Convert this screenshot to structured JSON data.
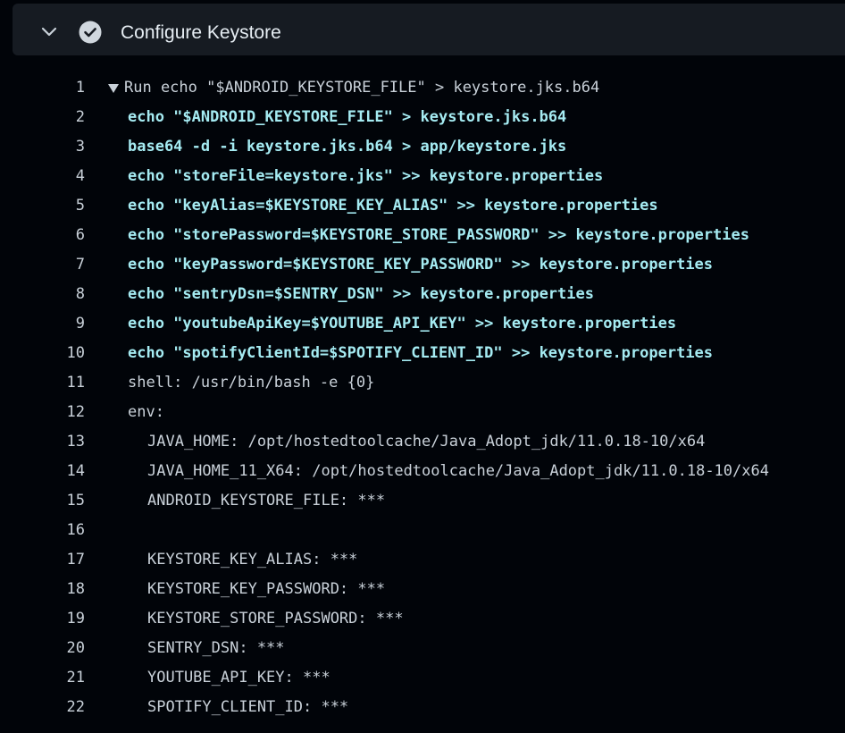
{
  "step": {
    "title": "Configure Keystore",
    "status": "success",
    "expanded": true,
    "chevron_icon": "chevron-down-icon",
    "status_icon": "check-circle-icon"
  },
  "colors": {
    "background": "#010409",
    "header_background": "#161b22",
    "text": "#c9d1d9",
    "command_text": "#a5ebf2",
    "check_circle": "#d0d7de"
  },
  "log": {
    "lines": [
      {
        "number": "1",
        "text": "Run echo \"$ANDROID_KEYSTORE_FILE\" > keystore.jks.b64",
        "kind": "run",
        "indent": 0
      },
      {
        "number": "2",
        "text": "echo \"$ANDROID_KEYSTORE_FILE\" > keystore.jks.b64",
        "kind": "cmd",
        "indent": 1
      },
      {
        "number": "3",
        "text": "base64 -d -i keystore.jks.b64 > app/keystore.jks",
        "kind": "cmd",
        "indent": 1
      },
      {
        "number": "4",
        "text": "echo \"storeFile=keystore.jks\" >> keystore.properties",
        "kind": "cmd",
        "indent": 1
      },
      {
        "number": "5",
        "text": "echo \"keyAlias=$KEYSTORE_KEY_ALIAS\" >> keystore.properties",
        "kind": "cmd",
        "indent": 1
      },
      {
        "number": "6",
        "text": "echo \"storePassword=$KEYSTORE_STORE_PASSWORD\" >> keystore.properties",
        "kind": "cmd",
        "indent": 1
      },
      {
        "number": "7",
        "text": "echo \"keyPassword=$KEYSTORE_KEY_PASSWORD\" >> keystore.properties",
        "kind": "cmd",
        "indent": 1
      },
      {
        "number": "8",
        "text": "echo \"sentryDsn=$SENTRY_DSN\" >> keystore.properties",
        "kind": "cmd",
        "indent": 1
      },
      {
        "number": "9",
        "text": "echo \"youtubeApiKey=$YOUTUBE_API_KEY\" >> keystore.properties",
        "kind": "cmd",
        "indent": 1
      },
      {
        "number": "10",
        "text": "echo \"spotifyClientId=$SPOTIFY_CLIENT_ID\" >> keystore.properties",
        "kind": "cmd",
        "indent": 1
      },
      {
        "number": "11",
        "text": "shell: /usr/bin/bash -e {0}",
        "kind": "plain",
        "indent": 1
      },
      {
        "number": "12",
        "text": "env:",
        "kind": "plain",
        "indent": 1
      },
      {
        "number": "13",
        "text": "JAVA_HOME: /opt/hostedtoolcache/Java_Adopt_jdk/11.0.18-10/x64",
        "kind": "plain",
        "indent": 2
      },
      {
        "number": "14",
        "text": "JAVA_HOME_11_X64: /opt/hostedtoolcache/Java_Adopt_jdk/11.0.18-10/x64",
        "kind": "plain",
        "indent": 2
      },
      {
        "number": "15",
        "text": "ANDROID_KEYSTORE_FILE: ***",
        "kind": "plain",
        "indent": 2
      },
      {
        "number": "16",
        "text": "",
        "kind": "plain",
        "indent": 2
      },
      {
        "number": "17",
        "text": "KEYSTORE_KEY_ALIAS: ***",
        "kind": "plain",
        "indent": 2
      },
      {
        "number": "18",
        "text": "KEYSTORE_KEY_PASSWORD: ***",
        "kind": "plain",
        "indent": 2
      },
      {
        "number": "19",
        "text": "KEYSTORE_STORE_PASSWORD: ***",
        "kind": "plain",
        "indent": 2
      },
      {
        "number": "20",
        "text": "SENTRY_DSN: ***",
        "kind": "plain",
        "indent": 2
      },
      {
        "number": "21",
        "text": "YOUTUBE_API_KEY: ***",
        "kind": "plain",
        "indent": 2
      },
      {
        "number": "22",
        "text": "SPOTIFY_CLIENT_ID: ***",
        "kind": "plain",
        "indent": 2
      }
    ]
  }
}
